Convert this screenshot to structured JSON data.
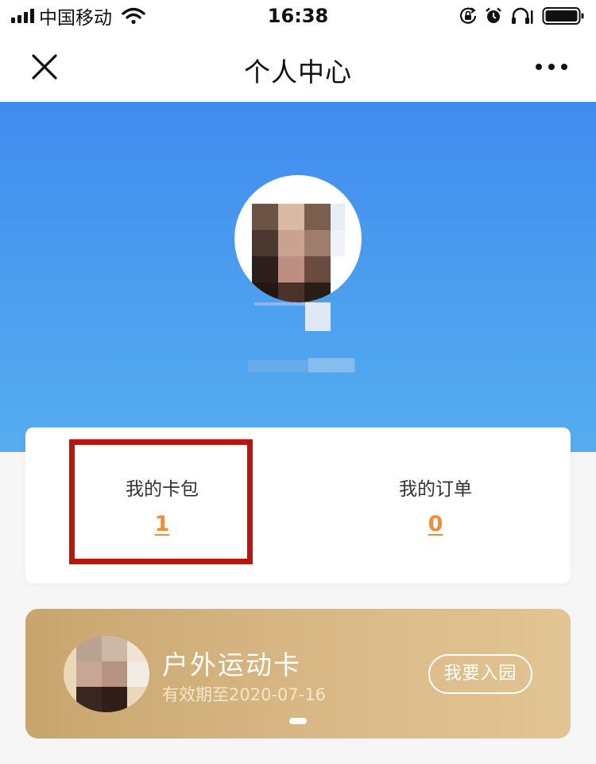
{
  "status_bar": {
    "carrier": "中国移动",
    "time": "16:38"
  },
  "navbar": {
    "title": "个人中心"
  },
  "stats": {
    "wallet_label": "我的卡包",
    "wallet_value": "1",
    "orders_label": "我的订单",
    "orders_value": "0"
  },
  "member_card": {
    "title": "户外运动卡",
    "expiry": "有效期至2020-07-16",
    "enter_label": "我要入园"
  },
  "colors": {
    "hero_top": "#3f8bef",
    "hero_bottom": "#56adef",
    "accent_orange": "#e8903f",
    "highlight_red": "#b8160e",
    "card_gold": "#d8b785"
  },
  "icons": {
    "close": "close-icon",
    "more": "more-icon",
    "wifi": "wifi-icon",
    "battery": "battery-icon"
  }
}
